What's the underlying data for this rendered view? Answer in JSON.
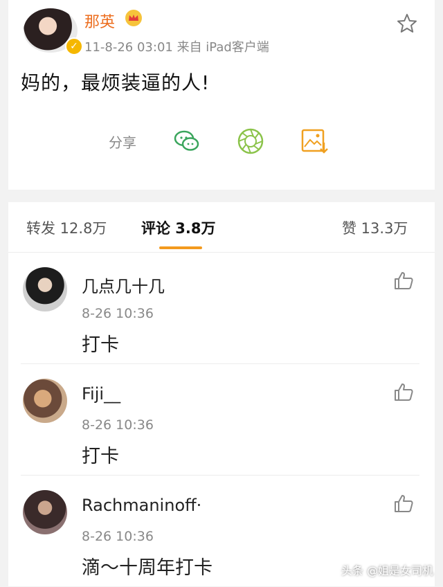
{
  "post": {
    "author": "那英",
    "meta": "11-8-26 03:01  来自 iPad客户端",
    "text": "妈的，最烦装逼的人!",
    "share_label": "分享",
    "icons": [
      "wechat-icon",
      "moments-icon",
      "save-image-icon",
      "star-icon"
    ]
  },
  "tabs": {
    "repost": "转发 12.8万",
    "comments": "评论 3.8万",
    "likes": "赞 13.3万"
  },
  "comments": [
    {
      "name": "几点几十几",
      "time": "8-26 10:36",
      "text": "打卡"
    },
    {
      "name": "Fiji__",
      "time": "8-26 10:36",
      "text": "打卡"
    },
    {
      "name": "Rachmaninoff·",
      "time": "8-26 10:36",
      "text": "滴～十周年打卡"
    }
  ],
  "watermark": "头条 @姐是女司机",
  "colors": {
    "accent": "#f39a1e",
    "author_name": "#ec6d1e",
    "share_green": "#4caf50"
  }
}
